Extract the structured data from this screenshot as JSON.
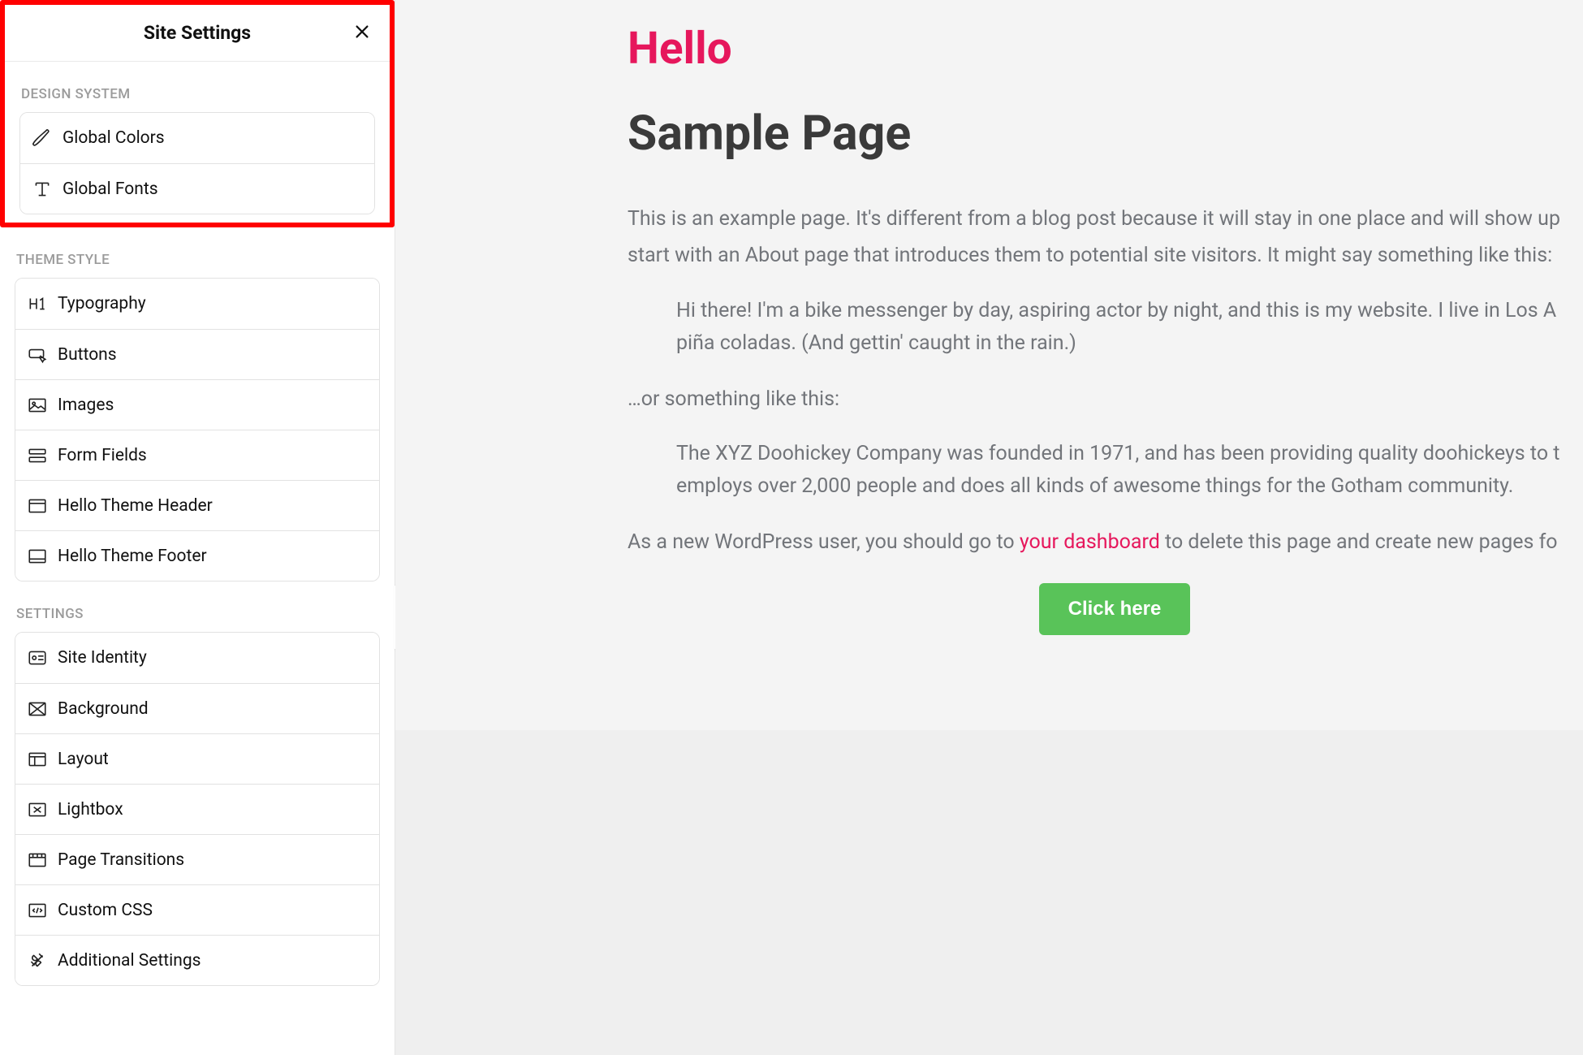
{
  "sidebar": {
    "title": "Site Settings",
    "sections": {
      "design_system": {
        "label": "DESIGN SYSTEM",
        "items": [
          {
            "label": "Global Colors",
            "icon": "brush-icon",
            "name": "global-colors"
          },
          {
            "label": "Global Fonts",
            "icon": "font-icon",
            "name": "global-fonts"
          }
        ]
      },
      "theme_style": {
        "label": "THEME STYLE",
        "items": [
          {
            "label": "Typography",
            "icon": "h1-icon",
            "name": "typography"
          },
          {
            "label": "Buttons",
            "icon": "button-cursor-icon",
            "name": "buttons"
          },
          {
            "label": "Images",
            "icon": "image-icon",
            "name": "images"
          },
          {
            "label": "Form Fields",
            "icon": "form-icon",
            "name": "form-fields"
          },
          {
            "label": "Hello Theme Header",
            "icon": "header-icon",
            "name": "hello-theme-header"
          },
          {
            "label": "Hello Theme Footer",
            "icon": "footer-icon",
            "name": "hello-theme-footer"
          }
        ]
      },
      "settings": {
        "label": "SETTINGS",
        "items": [
          {
            "label": "Site Identity",
            "icon": "identity-icon",
            "name": "site-identity"
          },
          {
            "label": "Background",
            "icon": "background-icon",
            "name": "background"
          },
          {
            "label": "Layout",
            "icon": "layout-icon",
            "name": "layout"
          },
          {
            "label": "Lightbox",
            "icon": "lightbox-icon",
            "name": "lightbox"
          },
          {
            "label": "Page Transitions",
            "icon": "transitions-icon",
            "name": "page-transitions"
          },
          {
            "label": "Custom CSS",
            "icon": "code-icon",
            "name": "custom-css"
          },
          {
            "label": "Additional Settings",
            "icon": "tools-icon",
            "name": "additional-settings"
          }
        ]
      }
    }
  },
  "preview": {
    "brand": "Hello",
    "heading": "Sample Page",
    "para1": "This is an example page. It's different from a blog post because it will stay in one place and will show up",
    "para1b": "start with an About page that introduces them to potential site visitors. It might say something like this:",
    "quote1a": "Hi there! I'm a bike messenger by day, aspiring actor by night, and this is my website. I live in Los A",
    "quote1b": "piña coladas. (And gettin' caught in the rain.)",
    "para2": "…or something like this:",
    "quote2a": "The XYZ Doohickey Company was founded in 1971, and has been providing quality doohickeys to t",
    "quote2b": "employs over 2,000 people and does all kinds of awesome things for the Gotham community.",
    "para3_pre": "As a new WordPress user, you should go to ",
    "para3_link": "your dashboard",
    "para3_post": " to delete this page and create new pages fo",
    "button": "Click here",
    "colors": {
      "accent": "#e6175c",
      "button_bg": "#59c359"
    }
  }
}
